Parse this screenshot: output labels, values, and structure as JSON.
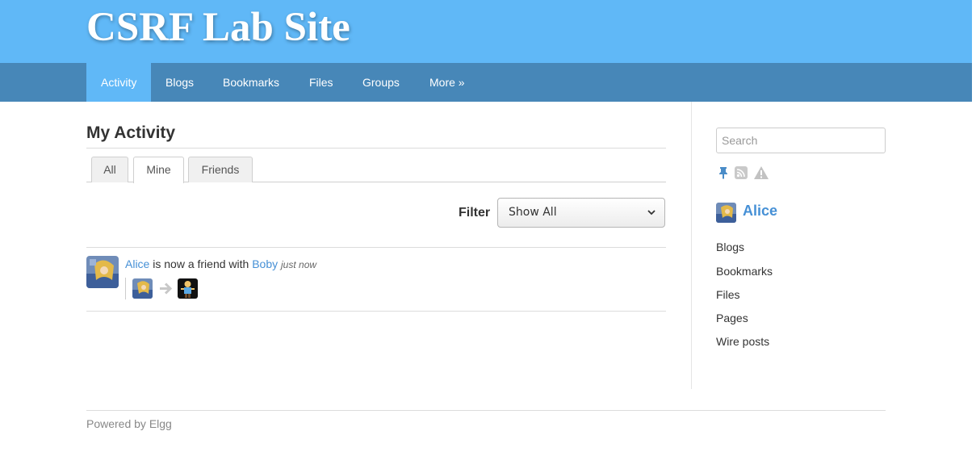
{
  "site": {
    "title": "CSRF Lab Site"
  },
  "nav": {
    "items": [
      {
        "label": "Activity",
        "active": true
      },
      {
        "label": "Blogs"
      },
      {
        "label": "Bookmarks"
      },
      {
        "label": "Files"
      },
      {
        "label": "Groups"
      },
      {
        "label": "More »"
      }
    ]
  },
  "main": {
    "heading": "My Activity",
    "tabs": [
      {
        "label": "All"
      },
      {
        "label": "Mine",
        "selected": true
      },
      {
        "label": "Friends"
      }
    ],
    "filter": {
      "label": "Filter",
      "value": "Show All"
    },
    "activity": [
      {
        "actor": "Alice",
        "verb": "is now a friend with",
        "object": "Boby",
        "time": "just now"
      }
    ]
  },
  "sidebar": {
    "search_placeholder": "Search",
    "owner_name": "Alice",
    "links": [
      "Blogs",
      "Bookmarks",
      "Files",
      "Pages",
      "Wire posts"
    ]
  },
  "footer": {
    "text": "Powered by Elgg"
  },
  "colors": {
    "header": "#60b8f7",
    "nav": "#4787b8",
    "link": "#4690d6"
  }
}
